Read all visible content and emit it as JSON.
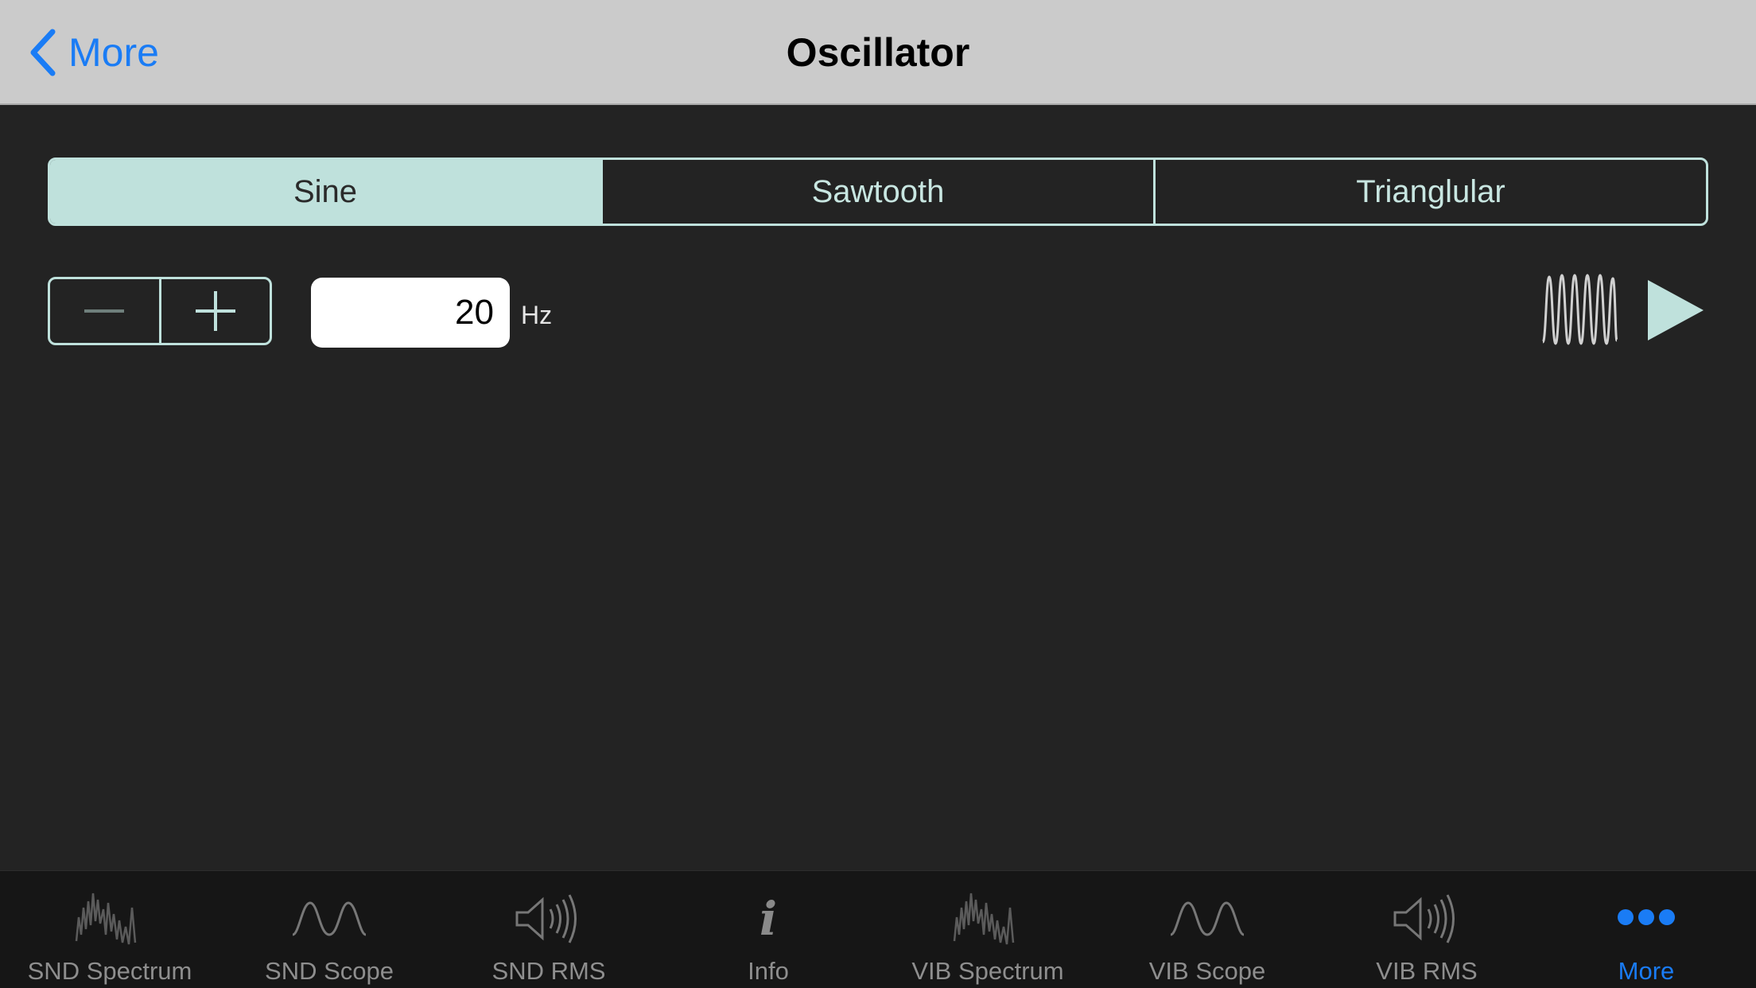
{
  "navbar": {
    "back_label": "More",
    "title": "Oscillator"
  },
  "waveform": {
    "options": [
      "Sine",
      "Sawtooth",
      "Trianglular"
    ],
    "selected": "Sine"
  },
  "frequency": {
    "value": "20",
    "unit": "Hz"
  },
  "tabs": [
    {
      "label": "SND Spectrum",
      "icon": "spectrum-icon"
    },
    {
      "label": "SND Scope",
      "icon": "scope-icon"
    },
    {
      "label": "SND RMS",
      "icon": "speaker-icon"
    },
    {
      "label": "Info",
      "icon": "info-icon"
    },
    {
      "label": "VIB Spectrum",
      "icon": "spectrum-icon"
    },
    {
      "label": "VIB Scope",
      "icon": "scope-icon"
    },
    {
      "label": "VIB RMS",
      "icon": "speaker-icon"
    },
    {
      "label": "More",
      "icon": "more-icon"
    }
  ],
  "colors": {
    "accent": "#1a7cf5",
    "segment": "#bfe1dc",
    "background": "#232323",
    "navbar": "#cbcbcb"
  }
}
